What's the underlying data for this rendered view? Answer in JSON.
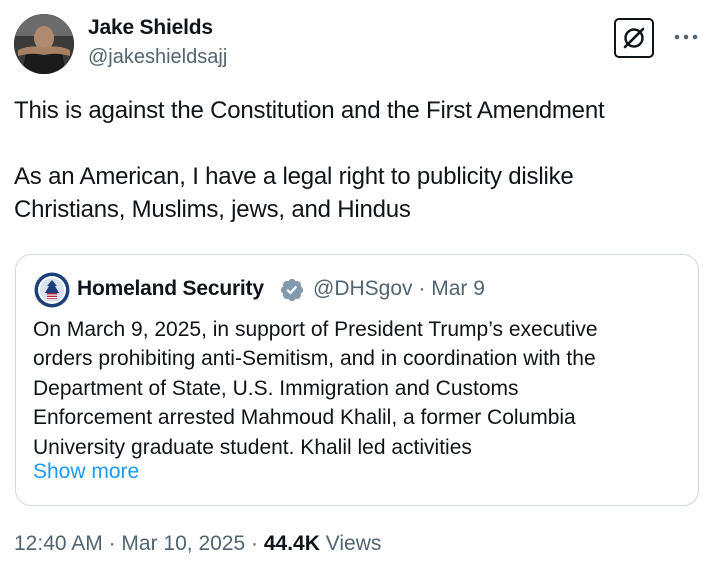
{
  "author": {
    "name": "Jake Shields",
    "handle": "@jakeshieldsajj"
  },
  "icons": {
    "grok": "grok-icon",
    "more": "more-dots-icon",
    "verified": "verified-gray-badge-icon",
    "quote_avatar": "dhs-seal-icon"
  },
  "tweet": {
    "lines": [
      "This is against the Constitution and the First Amendment",
      "As an American, I have a legal right to publicity dislike",
      "Christians, Muslims, jews, and Hindus"
    ]
  },
  "quote": {
    "name": "Homeland Security",
    "handle": "@DHSgov",
    "separator": "·",
    "date": "Mar 9",
    "lines": [
      "On March 9, 2025, in support of President Trump’s executive",
      "orders prohibiting anti-Semitism, and in coordination with the",
      "Department of State, U.S. Immigration and Customs",
      "Enforcement arrested Mahmoud Khalil, a former Columbia",
      "University graduate student. Khalil led activities"
    ],
    "show_more": "Show more"
  },
  "footer": {
    "time": "12:40 AM",
    "sep1": "·",
    "date": "Mar 10, 2025",
    "sep2": "·",
    "views_count": "44.4K",
    "views_label": "Views"
  },
  "colors": {
    "text": "#0f1419",
    "secondary": "#536471",
    "link": "#1d9bf0",
    "border": "#cfd9de",
    "verified_badge": "#829aab"
  }
}
